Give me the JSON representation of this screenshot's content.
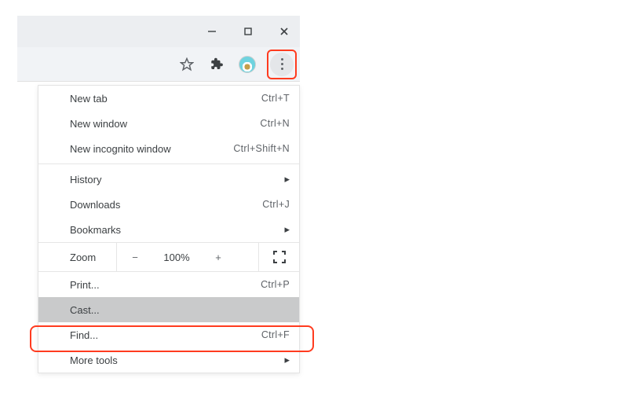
{
  "menu": {
    "new_tab": {
      "label": "New tab",
      "shortcut": "Ctrl+T"
    },
    "new_window": {
      "label": "New window",
      "shortcut": "Ctrl+N"
    },
    "new_incognito": {
      "label": "New incognito window",
      "shortcut": "Ctrl+Shift+N"
    },
    "history": {
      "label": "History"
    },
    "downloads": {
      "label": "Downloads",
      "shortcut": "Ctrl+J"
    },
    "bookmarks": {
      "label": "Bookmarks"
    },
    "zoom": {
      "label": "Zoom",
      "value": "100%",
      "minus": "−",
      "plus": "+"
    },
    "print": {
      "label": "Print...",
      "shortcut": "Ctrl+P"
    },
    "cast": {
      "label": "Cast..."
    },
    "find": {
      "label": "Find...",
      "shortcut": "Ctrl+F"
    },
    "more_tools": {
      "label": "More tools"
    }
  }
}
